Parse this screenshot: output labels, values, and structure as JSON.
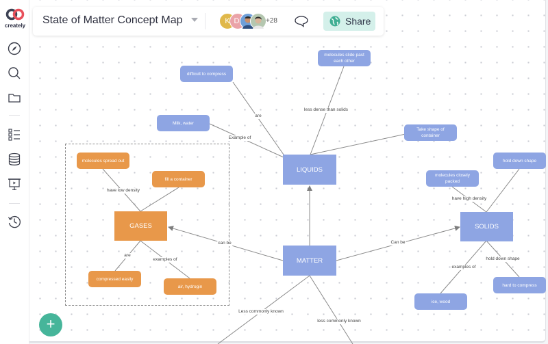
{
  "app": {
    "brand": "creately"
  },
  "header": {
    "title": "State of Matter Concept Map",
    "collaborators": [
      {
        "initial": "K",
        "color": "#e0b84a"
      },
      {
        "initial": "DI",
        "color": "#eaa3a8"
      },
      {
        "initial": "",
        "color": "#6f9fd8"
      },
      {
        "initial": "",
        "color": "#b5c7b0"
      }
    ],
    "more_collaborators": "+28",
    "share_label": "Share",
    "accent_color": "#d4f0ea"
  },
  "sidebar": {
    "items": [
      {
        "name": "explore"
      },
      {
        "name": "search"
      },
      {
        "name": "folder"
      },
      {
        "name": "checklist"
      },
      {
        "name": "database"
      },
      {
        "name": "presentation"
      },
      {
        "name": "history"
      }
    ]
  },
  "diagram": {
    "colors": {
      "concept": "#8ea5e3",
      "gas": "#e8984a",
      "line": "#7d7d7d"
    },
    "nodes": {
      "matter": "MATTER",
      "liquids": "LIQUIDS",
      "gases": "GASES",
      "solids": "SOLIDS",
      "difficult_to_compress": "difficult to compress",
      "molecules_slide": "molecules slide past each other",
      "milk_water": "Milk, water",
      "take_shape": "Take shape of container",
      "molecules_spread": "molecules spread out",
      "fill_container": "fill a container",
      "compressed_easily": "compressed easily",
      "air_hydrogen": "air, hydrogin",
      "molecules_closely": "molecules closely packed",
      "hold_down_shape_node": "hold down shape",
      "hard_to_compress": "hard to compress",
      "ice_wood": "ice, wood"
    },
    "edge_labels": {
      "are_liquids": "are",
      "less_dense": "less dense than solids",
      "example_of": "Example of",
      "have_low_density": "have low density",
      "are_gases": "are",
      "examples_of_gases": "examples of",
      "can_be_gases": "can be",
      "can_be_solids": "Can be",
      "have_high_density": "have high density",
      "examples_of_solids": "examples of",
      "hold_down_shape": "hold down shape",
      "less_common_left": "Less commonly known",
      "less_common_right": "less commonly known"
    }
  },
  "fab": {
    "label": "+"
  }
}
